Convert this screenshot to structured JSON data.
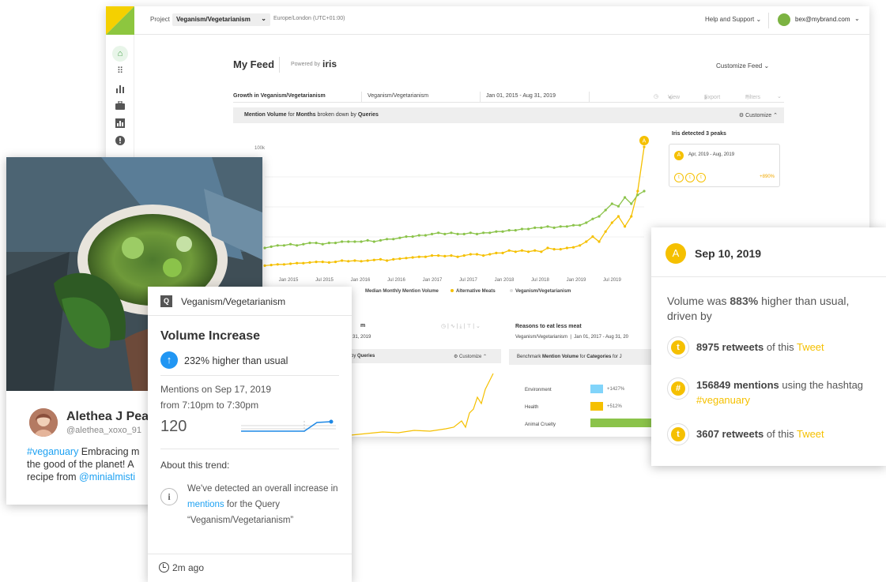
{
  "topbar": {
    "project_label": "Project",
    "project_value": "Veganism/Vegetarianism",
    "timezone": "Europe/London (UTC+01:00)",
    "help_label": "Help and Support",
    "user_email": "bex@mybrand.com",
    "brand_colors": {
      "green": "#8dc63f",
      "yellow": "#f5d000"
    }
  },
  "sidebar": {
    "icons": [
      "home-icon",
      "apps-grid-icon",
      "bar-chart-icon",
      "briefcase-icon",
      "report-icon",
      "alert-icon"
    ]
  },
  "feed": {
    "title": "My Feed",
    "powered_by": "Powered by",
    "iris": "iris",
    "customize_feed": "Customize Feed"
  },
  "widget": {
    "name": "Growth in Veganism/Vegetarianism",
    "query": "Veganism/Vegetarianism",
    "date_range": "Jan 01, 2015 - Aug 31, 2019",
    "view": "View",
    "export": "Export",
    "filters": "Filters",
    "mv_prefix": "Mention Volume",
    "mv_for": "for",
    "mv_months": "Months",
    "mv_broken": "broken down by",
    "mv_queries": "Queries",
    "customize": "Customize"
  },
  "chart_data": {
    "type": "line",
    "x": [
      "Jan 2015",
      "Jul 2015",
      "Jan 2016",
      "Jul 2016",
      "Jan 2017",
      "Jul 2017",
      "Jan 2018",
      "Jul 2018",
      "Jan 2019",
      "Jul 2019"
    ],
    "yticks": [
      "100k"
    ],
    "legend": [
      "Median Monthly Mention Volume",
      "Alternative Meats",
      "Veganism/Vegetarianism"
    ],
    "series": [
      {
        "name": "Alternative Meats",
        "color": "#f5c000",
        "values": [
          1,
          1.5,
          2,
          2,
          2.5,
          3,
          3,
          3.5,
          4,
          4,
          3.5,
          4,
          5,
          4.5,
          5,
          4.5,
          5,
          5.5,
          6,
          5,
          6,
          6.5,
          7,
          7.5,
          8,
          8,
          9,
          9,
          8.5,
          9,
          8,
          9,
          10,
          10,
          9,
          10,
          11,
          11,
          13,
          12,
          13,
          12,
          13,
          12,
          15,
          14,
          14,
          15,
          15.5,
          17,
          20,
          24,
          20,
          28,
          35,
          40,
          32,
          40,
          60,
          95
        ]
      },
      {
        "name": "Veganism/Vegetarianism",
        "color": "#8bc34a",
        "values": [
          15,
          16,
          17,
          17,
          18,
          17,
          18,
          19,
          19,
          18,
          19,
          19,
          20,
          20,
          20,
          20,
          21,
          20,
          21,
          22,
          22,
          23,
          24,
          24,
          25,
          25,
          26,
          27,
          26,
          27,
          26,
          26,
          27,
          26,
          27,
          27,
          28,
          28,
          29,
          29,
          30,
          30,
          31,
          31,
          32,
          31,
          32,
          32,
          33,
          33,
          35,
          38,
          40,
          45,
          50,
          48,
          55,
          50,
          57,
          60
        ]
      }
    ],
    "peak_marker": "A"
  },
  "peaks": {
    "title": "Iris detected 3 peaks",
    "badge": "A",
    "range": "Apr, 2019 - Aug, 2019",
    "pct": "+890%"
  },
  "widget2": {
    "head": "m",
    "date": "31, 2019",
    "by": "by",
    "queries": "Queries",
    "customize": "Customize"
  },
  "widget3": {
    "title": "Reasons to eat less meat",
    "query": "Veganism/Vegetarianism",
    "date": "Jan 01, 2017 - Aug 31, 20",
    "bar_prefix": "Benchmark",
    "bar_mv": "Mention Volume",
    "bar_for": "for",
    "bar_categories": "Categories",
    "bar_tail": "for J",
    "categories": [
      {
        "label": "Environment",
        "pct": "+1427%",
        "color": "#81d4fa"
      },
      {
        "label": "Health",
        "pct": "+512%",
        "color": "#f5c000"
      },
      {
        "label": "Animal Cruelty",
        "pct": "",
        "color": "#8bc34a"
      }
    ]
  },
  "post": {
    "name": "Alethea J Pea",
    "handle": "@alethea_xoxo_91",
    "hashtag": "#veganuary",
    "text1": " Embracing m",
    "text2": "the good of the planet! A",
    "text3": "recipe from ",
    "mention": "@minialmisti"
  },
  "trend": {
    "q_badge": "Q",
    "query": "Veganism/Vegetarianism",
    "title": "Volume Increase",
    "higher": "232% higher than usual",
    "mentions_on": "Mentions on Sep 17, 2019",
    "time_range": "from 7:10pm to 7:30pm",
    "count": "120",
    "about": "About this trend:",
    "desc1": "We've detected an overall increase in ",
    "desc_link": "mentions",
    "desc2": " for the Query “Veganism/Vegetarianism”",
    "ago": "2m ago"
  },
  "peak_card": {
    "badge": "A",
    "date": "Sep 10, 2019",
    "vol_pre": "Volume was ",
    "vol_pct": "883%",
    "vol_post": " higher than usual, driven by",
    "rows": [
      {
        "icon": "twitter-icon",
        "bold": "8975 retweets",
        "mid": " of this ",
        "hl": "Tweet"
      },
      {
        "icon": "hashtag-icon",
        "bold": "156849 mentions",
        "mid": " using the hashtag ",
        "hl": "#veganuary"
      },
      {
        "icon": "twitter-icon",
        "bold": "3607 retweets",
        "mid": " of this ",
        "hl": "Tweet"
      }
    ]
  }
}
